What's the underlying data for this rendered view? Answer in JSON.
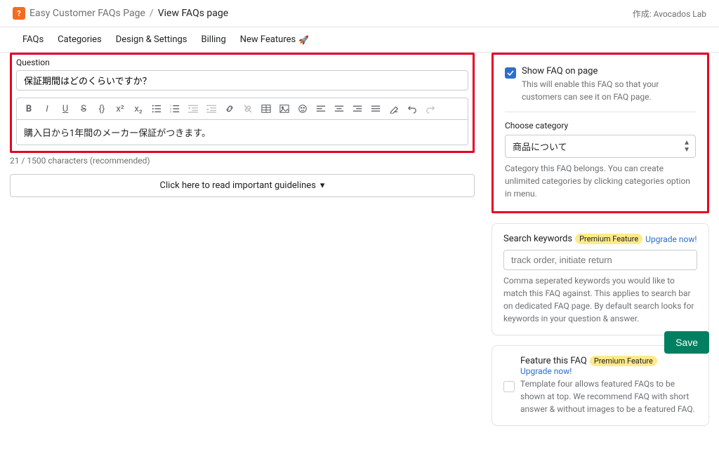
{
  "header": {
    "app_icon_char": "?",
    "app_name": "Easy Customer FAQs Page",
    "separator": "/",
    "page_title": "View FAQs page",
    "created_by": "作成: Avocados Lab"
  },
  "nav": {
    "faqs": "FAQs",
    "categories": "Categories",
    "design": "Design & Settings",
    "billing": "Billing",
    "new_features": "New Features",
    "rocket": "🚀"
  },
  "editor": {
    "question_label": "Question",
    "question_value": "保証期間はどのくらいですか？",
    "answer_value": "購入日から1年間のメーカー保証がつきます。",
    "char_count": "21 / 1500 characters (recommended)",
    "guidelines_btn": "Click here to read important guidelines"
  },
  "show_faq": {
    "title": "Show FAQ on page",
    "help": "This will enable this FAQ so that your customers can see it on FAQ page."
  },
  "category": {
    "label": "Choose category",
    "selected": "商品について",
    "help": "Category this FAQ belongs. You can create unlimited categories by clicking categories option in menu."
  },
  "keywords": {
    "label": "Search keywords",
    "premium_badge": "Premium Feature",
    "upgrade": "Upgrade now!",
    "placeholder": "track order, initiate return",
    "help": "Comma seperated keywords you would like to match this FAQ against. This applies to search bar on dedicated FAQ page. By default search looks for keywords in your question & answer."
  },
  "feature": {
    "label": "Feature this FAQ",
    "premium_badge": "Premium Feature",
    "upgrade": "Upgrade now!",
    "help": "Template four allows featured FAQs to be shown at top. We recommend FAQ with short answer & without images to be a featured FAQ."
  },
  "actions": {
    "save": "Save"
  }
}
